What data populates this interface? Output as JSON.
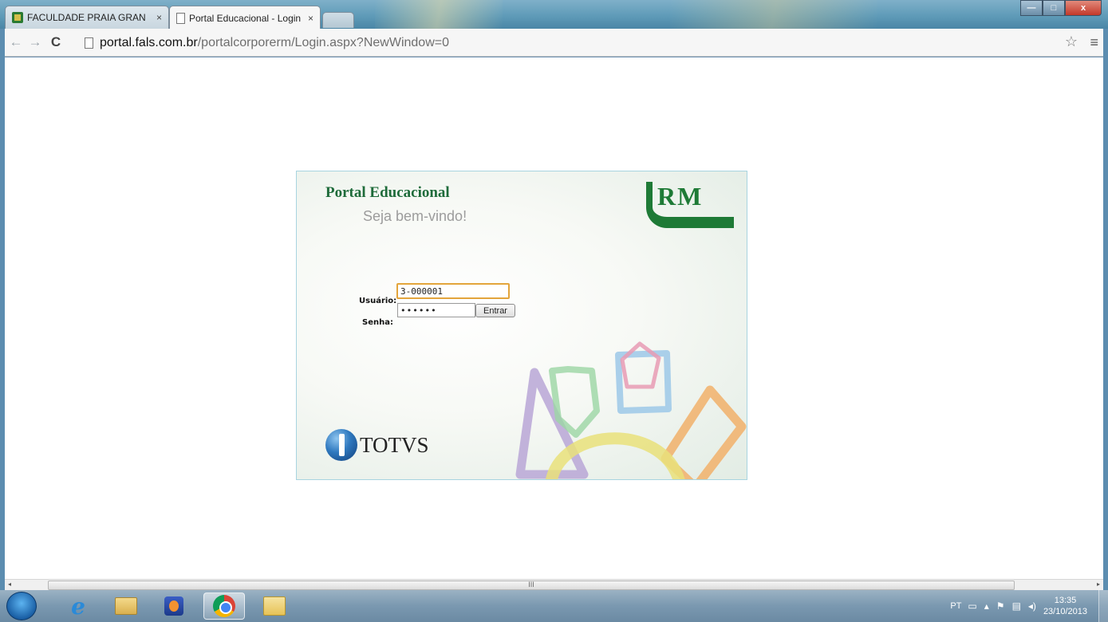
{
  "tabs": [
    {
      "title": "FACULDADE PRAIA GRAN",
      "close": "×"
    },
    {
      "title": "Portal Educacional - Login",
      "close": "×"
    }
  ],
  "window_controls": {
    "minimize": "—",
    "maximize": "□",
    "close": "x"
  },
  "toolbar": {
    "back": "←",
    "forward": "→",
    "reload": "C",
    "url_host": "portal.fals.com.br",
    "url_path": "/portalcorporerm/Login.aspx?NewWindow=0",
    "star": "☆",
    "menu": "≡"
  },
  "login": {
    "title": "Portal Educacional",
    "welcome": "Seja bem-vindo!",
    "rm_logo": "RM",
    "user_label": "Usuário:",
    "pass_label": "Senha:",
    "user_value": "3-000001",
    "pass_value": "••••••",
    "submit_label": "Entrar",
    "brand": "TOTVS"
  },
  "scrollbar": {
    "grip": "III",
    "left": "◂",
    "right": "▸"
  },
  "taskbar": {
    "language": "PT",
    "keyboard": "▭",
    "tray_expand": "▴",
    "flag": "⚑",
    "network": "▤",
    "volume": "◂)",
    "time": "13:35",
    "date": "23/10/2013"
  },
  "colors": {
    "portal_green": "#1e6b3a",
    "rm_green": "#1e7a36",
    "focus_border": "#e3a53c"
  }
}
